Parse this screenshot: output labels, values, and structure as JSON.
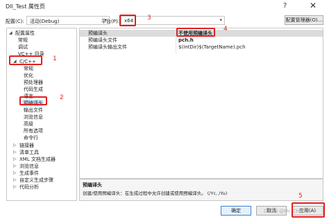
{
  "window": {
    "title": "Dll_Test 属性页",
    "help_glyph": "?",
    "close_glyph": "✕"
  },
  "config_row": {
    "config_label": "配置(C):",
    "config_value": "活动(Debug)",
    "platform_label": "平台(P):",
    "platform_value": "x64",
    "config_manager_label": "配置管理器(O)..."
  },
  "tree": {
    "items": [
      {
        "label": "配置属性",
        "expander": "◢"
      },
      {
        "label": "常规"
      },
      {
        "label": "调试"
      },
      {
        "label": "VC++ 目录"
      },
      {
        "label": "C/C++",
        "expander": "◢"
      },
      {
        "label": "常规"
      },
      {
        "label": "优化"
      },
      {
        "label": "预处理器"
      },
      {
        "label": "代码生成"
      },
      {
        "label": "语言"
      },
      {
        "label": "预编译头"
      },
      {
        "label": "输出文件"
      },
      {
        "label": "浏览信息"
      },
      {
        "label": "高级"
      },
      {
        "label": "所有选项"
      },
      {
        "label": "命令行"
      },
      {
        "label": "链接器",
        "expander": "▷"
      },
      {
        "label": "清单工具",
        "expander": "▷"
      },
      {
        "label": "XML 文档生成器",
        "expander": "▷"
      },
      {
        "label": "浏览信息",
        "expander": "▷"
      },
      {
        "label": "生成事件",
        "expander": "▷"
      },
      {
        "label": "自定义生成步骤",
        "expander": "▷"
      },
      {
        "label": "代码分析",
        "expander": "▷"
      }
    ]
  },
  "grid": {
    "rows": [
      {
        "name": "预编译头",
        "value": "不使用预编译头"
      },
      {
        "name": "预编译头文件",
        "value": "pch.h"
      },
      {
        "name": "预编译头输出文件",
        "value": "$(IntDir)$(TargetName).pch"
      }
    ]
  },
  "description": {
    "title": "预编译头",
    "text": "创建/使用预编译头：在生成过程中允许创建或使用预编译头。    (/Yc, /Yu)"
  },
  "buttons": {
    "ok": "确定",
    "cancel": "取消",
    "apply": "应用(A)"
  },
  "annotations": {
    "n1": "1",
    "n2": "2",
    "n3": "3",
    "n4": "4",
    "n5": "5"
  },
  "watermark": "CSDN @Mr_ChenL",
  "colors": {
    "annotation_red": "#e02020",
    "selection_blue": "#cce4f7"
  }
}
